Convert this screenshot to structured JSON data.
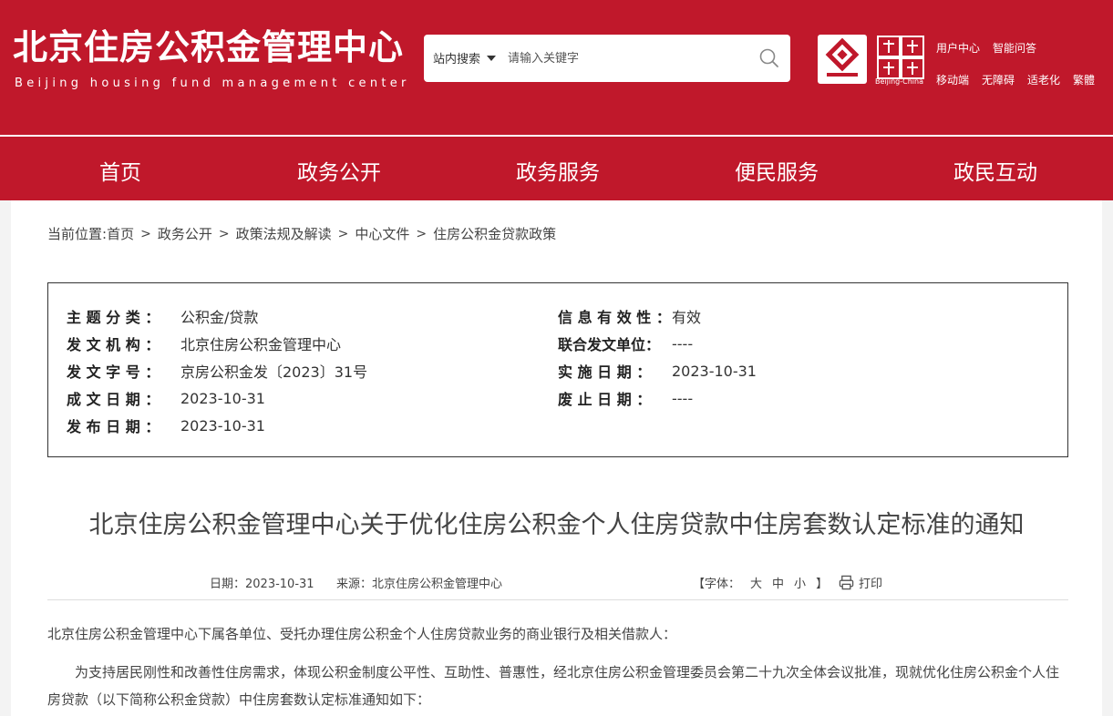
{
  "header": {
    "site_title": "北京住房公积金管理中心",
    "site_subtitle": "Beijing housing fund management center",
    "search": {
      "scope_label": "站内搜索",
      "placeholder": "请输入关键字",
      "icon": "search-icon"
    },
    "logos": {
      "fund_logo_icon": "housing-fund-logo",
      "capital_logo_icon": "capital-window-logo",
      "capital_caption": "Beijing-China"
    },
    "links_top": [
      "用户中心",
      "智能问答"
    ],
    "links_bottom": [
      "移动端",
      "无障碍",
      "适老化",
      "繁體"
    ]
  },
  "nav": {
    "items": [
      "首页",
      "政务公开",
      "政务服务",
      "便民服务",
      "政民互动"
    ]
  },
  "breadcrumb": {
    "prefix": "当前位置:",
    "items": [
      "首页",
      "政务公开",
      "政策法规及解读",
      "中心文件",
      "住房公积金贷款政策"
    ],
    "separator": ">"
  },
  "meta": {
    "left": [
      {
        "label": "主 题 分 类 ：",
        "value": "公积金/贷款"
      },
      {
        "label": "发 文 机 构 ：",
        "value": "北京住房公积金管理中心"
      },
      {
        "label": "发 文 字 号 ：",
        "value": "京房公积金发〔2023〕31号"
      },
      {
        "label": "成 文 日 期 ：",
        "value": "2023-10-31"
      },
      {
        "label": "发 布 日 期 ：",
        "value": "2023-10-31"
      }
    ],
    "right": [
      {
        "label": "信 息 有 效 性 ：",
        "value": "有效"
      },
      {
        "label": "联合发文单位：",
        "value": "----"
      },
      {
        "label": "实 施 日 期 ：",
        "value": "2023-10-31"
      },
      {
        "label": "废 止 日 期 ：",
        "value": "----"
      }
    ]
  },
  "article": {
    "title": "北京住房公积金管理中心关于优化住房公积金个人住房贷款中住房套数认定标准的通知",
    "date_text": "日期：2023-10-31",
    "source_text": "来源：北京住房公积金管理中心",
    "font_label": "【字体：",
    "font_sizes": [
      "大",
      "中",
      "小"
    ],
    "font_close": "】",
    "print_label": "打印",
    "paragraphs": [
      "北京住房公积金管理中心下属各单位、受托办理住房公积金个人住房贷款业务的商业银行及相关借款人：",
      "为支持居民刚性和改善性住房需求，体现公积金制度公平性、互助性、普惠性，经北京住房公积金管理委员会第二十九次全体会议批准，现就优化住房公积金个人住房贷款（以下简称公积金贷款）中住房套数认定标准通知如下："
    ]
  },
  "colors": {
    "brand_red": "#c0182b",
    "text": "#444444",
    "white": "#ffffff"
  }
}
